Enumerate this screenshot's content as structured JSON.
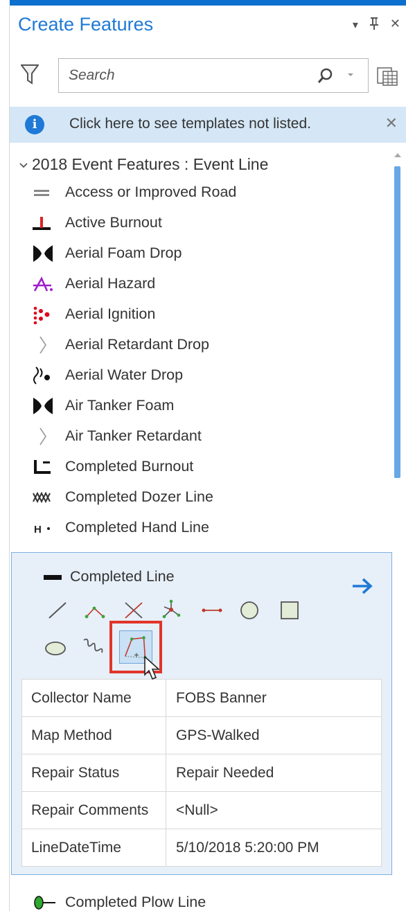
{
  "pane": {
    "title": "Create Features",
    "pin_label": "−1",
    "close_label": "✕",
    "menu_label": "▾"
  },
  "search": {
    "placeholder": "Search"
  },
  "info_bar": {
    "icon": "i",
    "text": "Click here to see templates not listed.",
    "close": "✕"
  },
  "group": {
    "chevron": "∨",
    "title": "2018 Event Features : Event Line"
  },
  "templates": [
    {
      "label": "Access or Improved Road",
      "icon": "double-line-icon"
    },
    {
      "label": "Active Burnout",
      "icon": "burnout-t-icon"
    },
    {
      "label": "Aerial Foam Drop",
      "icon": "foam-drop-icon"
    },
    {
      "label": "Aerial Hazard",
      "icon": "hazard-icon"
    },
    {
      "label": "Aerial Ignition",
      "icon": "ignition-icon"
    },
    {
      "label": "Aerial Retardant Drop",
      "icon": "chevron-outline-icon"
    },
    {
      "label": "Aerial Water Drop",
      "icon": "water-drop-icon"
    },
    {
      "label": "Air Tanker Foam",
      "icon": "foam-drop-icon"
    },
    {
      "label": "Air Tanker Retardant",
      "icon": "chevron-outline-icon"
    },
    {
      "label": "Completed Burnout",
      "icon": "burnout-l-icon"
    },
    {
      "label": "Completed Dozer Line",
      "icon": "dozer-icon"
    },
    {
      "label": "Completed Hand Line",
      "icon": "hand-line-icon"
    }
  ],
  "selected_template": {
    "label": "Completed Line",
    "attributes": [
      {
        "key": "Collector Name",
        "value": "FOBS Banner"
      },
      {
        "key": "Map Method",
        "value": "GPS-Walked"
      },
      {
        "key": "Repair Status",
        "value": "Repair Needed"
      },
      {
        "key": "Repair Comments",
        "value": "<Null>"
      },
      {
        "key": "LineDateTime",
        "value": "5/10/2018 5:20:00 PM"
      }
    ],
    "tools": [
      "line-tool-icon",
      "right-angle-tool-icon",
      "arc-tool-icon",
      "midpoint-tool-icon",
      "trace-tool-icon",
      "circle-tool-icon",
      "rectangle-tool-icon",
      "ellipse-tool-icon",
      "freehand-tool-icon",
      "stream-tool-icon"
    ],
    "selected_tool": "stream-tool-icon"
  },
  "next_template": {
    "label": "Completed Plow Line",
    "icon": "plow-line-icon"
  },
  "colors": {
    "accent": "#1f79d6",
    "info_bg": "#d5e7f6",
    "selected_panel_bg": "#e7eff8",
    "highlight_red": "#e0352b",
    "scrollbar": "#68a8e6"
  }
}
